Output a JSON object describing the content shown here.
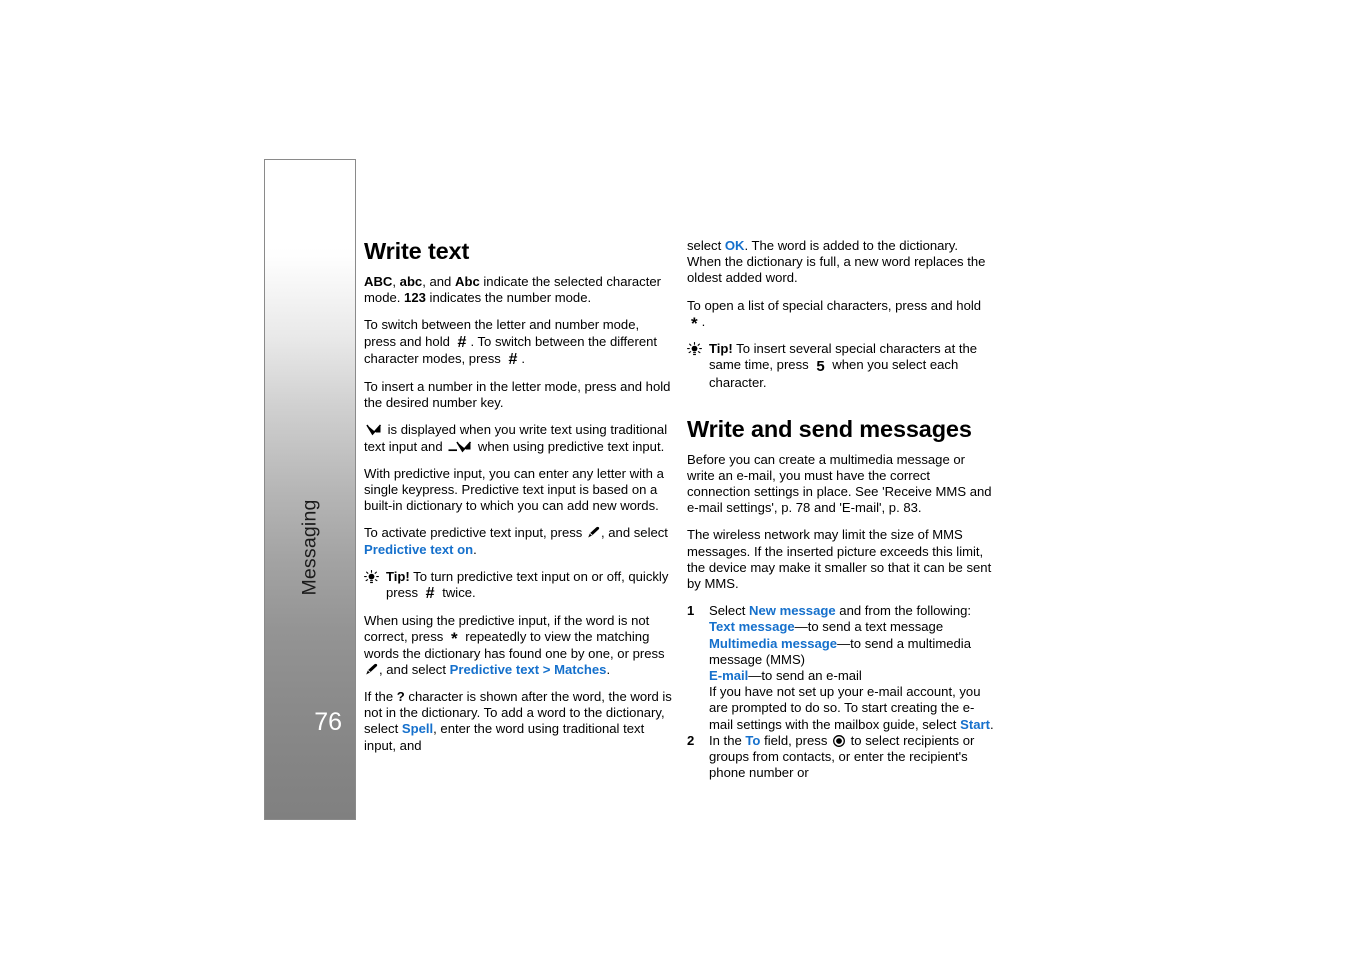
{
  "page": {
    "number": "76",
    "chapter": "Messaging",
    "link_color": "#1570cc"
  },
  "left_column": {
    "heading": "Write text",
    "p1": {
      "b1": "ABC",
      "t1": ", ",
      "b2": "abc",
      "t2": ", and ",
      "b3": "Abc",
      "t3": " indicate the selected character mode. ",
      "b4": "123",
      "t4": " indicates the number mode."
    },
    "p2": {
      "t1": "To switch between the letter and number mode, press and hold ",
      "key1": "#",
      "t2": ". To switch between the different character modes, press ",
      "key2": "#",
      "t3": "."
    },
    "p3": "To insert a number in the letter mode, press and hold the desired number key.",
    "p4": {
      "t1": " is displayed when you write text using traditional text input and ",
      "t2": " when using predictive text input."
    },
    "p5": "With predictive input, you can enter any letter with a single keypress. Predictive text input is based on a built-in dictionary to which you can add new words.",
    "p6": {
      "t1": "To activate predictive text input, press ",
      "t2": ", and select ",
      "link1": "Predictive text on",
      "t3": "."
    },
    "tip1": {
      "label": "Tip!",
      "t1": " To turn predictive text input on or off, quickly press ",
      "key1": "#",
      "t2": " twice."
    },
    "p7": {
      "t1": "When using the predictive input, if the word is not correct, press ",
      "key1": "*",
      "t2": " repeatedly to view the matching words the dictionary has found one by one, or press ",
      "t3": ", and select ",
      "link1": "Predictive text",
      "t4": " > ",
      "link2": "Matches",
      "t5": "."
    },
    "p8": {
      "t1": "If the ",
      "b1": "?",
      "t2": " character is shown after the word, the word is not in the dictionary. To add a word to the dictionary, select ",
      "link1": "Spell",
      "t3": ", enter the word using traditional text input, and"
    }
  },
  "right_column": {
    "p1": {
      "t1": "select ",
      "link1": "OK",
      "t2": ". The word is added to the dictionary. When the dictionary is full, a new word replaces the oldest added word."
    },
    "p2": {
      "t1": "To open a list of special characters, press and hold ",
      "key1": "*",
      "t2": "."
    },
    "tip1": {
      "label": "Tip!",
      "t1": " To insert several special characters at the same time, press ",
      "key1": "5",
      "t2": " when you select each character."
    },
    "heading": "Write and send messages",
    "p3": "Before you can create a multimedia message or write an e-mail, you must have the correct connection settings in place. See 'Receive MMS and e-mail settings', p. 78 and 'E-mail', p. 83.",
    "p4": "The wireless network may limit the size of MMS messages. If the inserted picture exceeds this limit, the device may make it smaller so that it can be sent by MMS.",
    "steps": {
      "step1": {
        "num": "1",
        "t1": "Select ",
        "link1": "New message",
        "t2": " and from the following:",
        "sub1_link": "Text message",
        "sub1_text": "—to send a text message",
        "sub2_link": "Multimedia message",
        "sub2_text": "—to send a multimedia message (MMS)",
        "sub3_link": "E-mail",
        "sub3_text": "—to send an e-mail",
        "sub4_t1": "If you have not set up your e-mail account, you are prompted to do so. To start creating the e-mail settings with the mailbox guide, select ",
        "sub4_link": "Start",
        "sub4_t2": "."
      },
      "step2": {
        "num": "2",
        "t1": "In the ",
        "link1": "To",
        "t2": " field, press ",
        "t3": " to select recipients or groups from contacts, or enter the recipient's phone number or"
      }
    }
  }
}
